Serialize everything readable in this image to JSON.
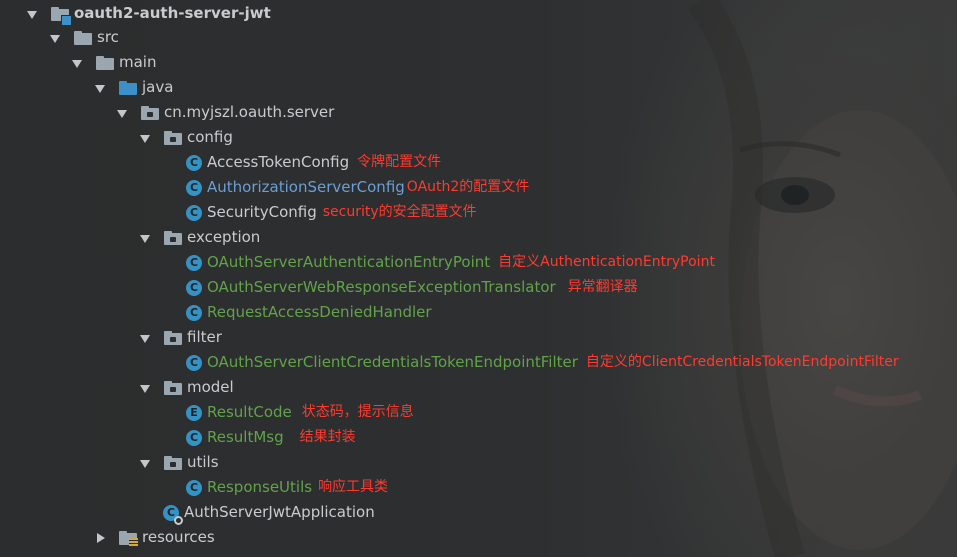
{
  "tree": {
    "root": {
      "label": "oauth2-auth-server-jwt"
    },
    "src": {
      "label": "src"
    },
    "main": {
      "label": "main"
    },
    "java": {
      "label": "java"
    },
    "pkg": {
      "label": "cn.myjszl.oauth.server"
    },
    "config": {
      "label": "config",
      "items": [
        {
          "label": "AccessTokenConfig",
          "icon": "C",
          "note": "令牌配置文件"
        },
        {
          "label": "AuthorizationServerConfig",
          "icon": "C",
          "note": "OAuth2的配置文件"
        },
        {
          "label": "SecurityConfig",
          "icon": "C",
          "note": "security的安全配置文件"
        }
      ]
    },
    "exception": {
      "label": "exception",
      "items": [
        {
          "label": "OAuthServerAuthenticationEntryPoint",
          "icon": "C",
          "note": "自定义AuthenticationEntryPoint"
        },
        {
          "label": "OAuthServerWebResponseExceptionTranslator",
          "icon": "C",
          "note": "异常翻译器"
        },
        {
          "label": "RequestAccessDeniedHandler",
          "icon": "C",
          "note": ""
        }
      ]
    },
    "filter": {
      "label": "filter",
      "items": [
        {
          "label": "OAuthServerClientCredentialsTokenEndpointFilter",
          "icon": "C",
          "note": "自定义的ClientCredentialsTokenEndpointFilter"
        }
      ]
    },
    "model": {
      "label": "model",
      "items": [
        {
          "label": "ResultCode",
          "icon": "E",
          "note": "状态码，提示信息"
        },
        {
          "label": "ResultMsg",
          "icon": "C",
          "note": "结果封装"
        }
      ]
    },
    "utils": {
      "label": "utils",
      "items": [
        {
          "label": "ResponseUtils",
          "icon": "C",
          "note": "响应工具类"
        }
      ]
    },
    "app": {
      "label": "AuthServerJwtApplication",
      "icon": "C"
    },
    "resources": {
      "label": "resources"
    }
  },
  "colors": {
    "annotation": "#ff3b30",
    "green_label": "#62a34a",
    "blue_label": "#6b9fd4",
    "default_label": "#c9ccce",
    "icon_blue": "#3592c4"
  }
}
